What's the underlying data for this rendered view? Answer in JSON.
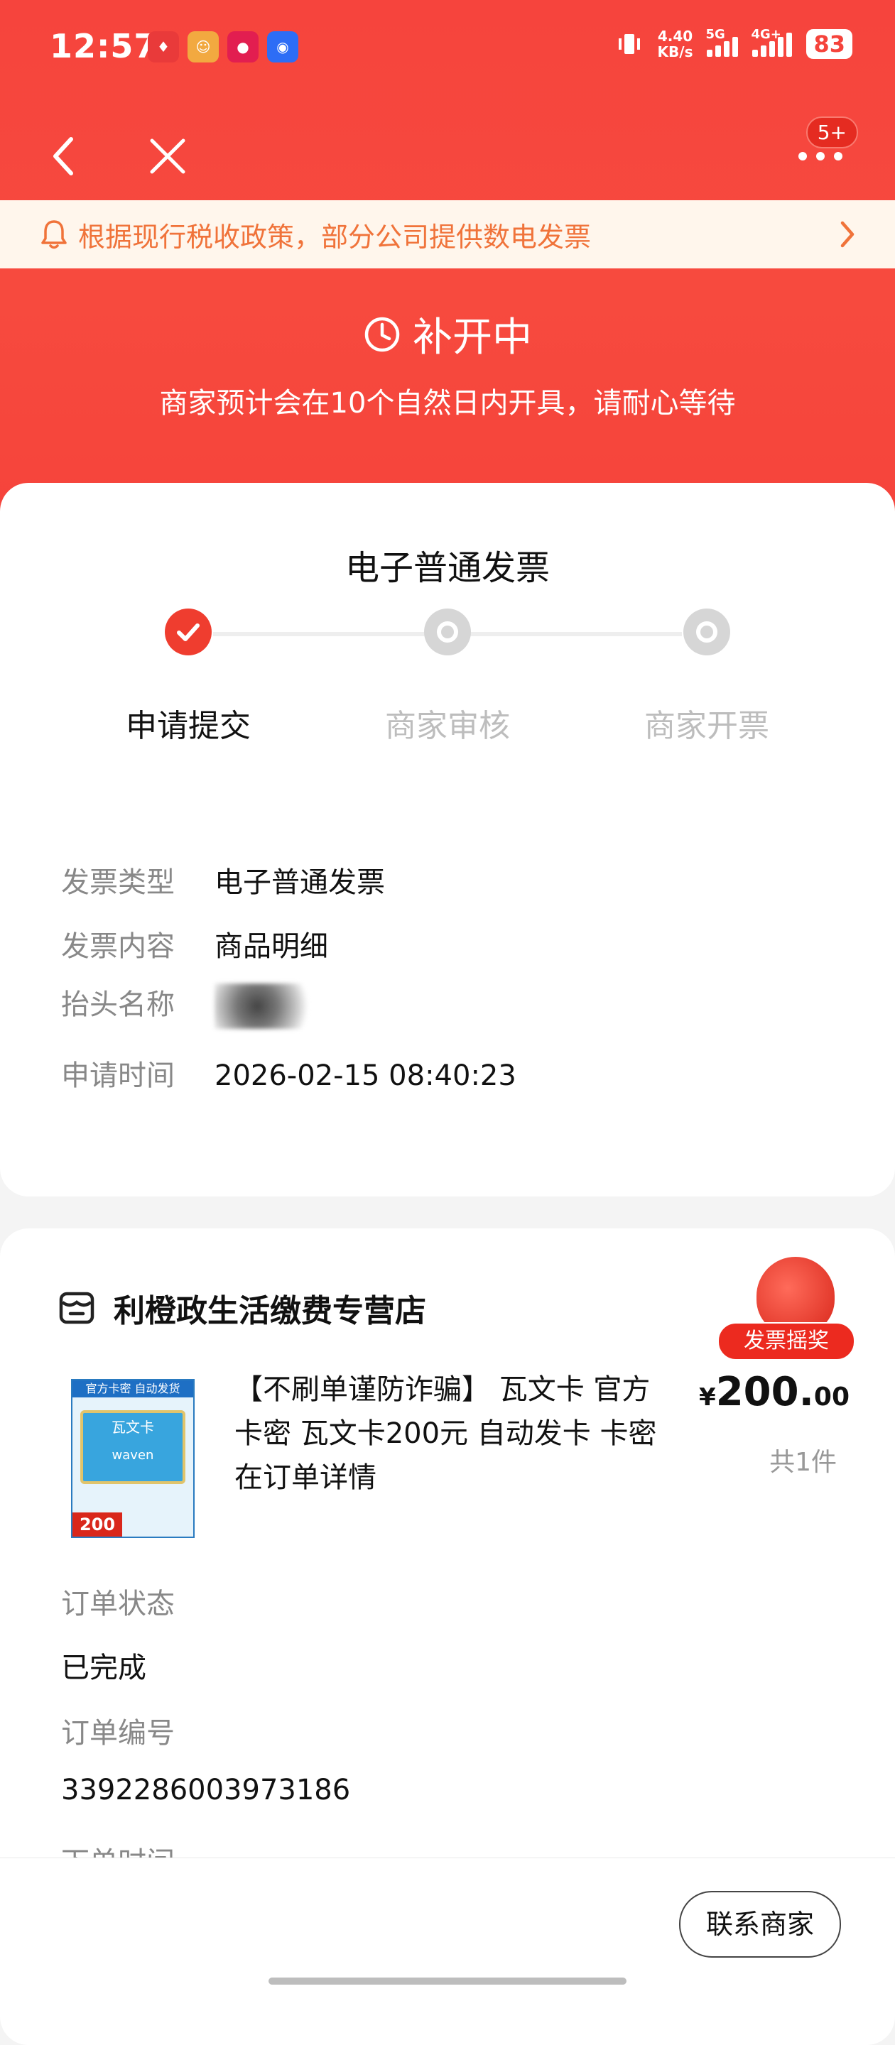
{
  "status_bar": {
    "time": "12:57",
    "speed_top": "4.40",
    "speed_bottom": "KB/s",
    "net1": "5G",
    "net2": "4G+",
    "battery": "83",
    "app_icons": [
      "app-icon-1",
      "app-icon-2",
      "app-icon-3",
      "app-icon-4"
    ]
  },
  "nav": {
    "badge": "5+"
  },
  "notice": {
    "text": "根据现行税收政策，部分公司提供数电发票"
  },
  "status": {
    "title": "补开中",
    "subtitle": "商家预计会在10个自然日内开具，请耐心等待"
  },
  "invoice": {
    "title": "电子普通发票",
    "steps": [
      {
        "label": "申请提交",
        "state": "done"
      },
      {
        "label": "商家审核",
        "state": "pending"
      },
      {
        "label": "商家开票",
        "state": "pending"
      }
    ],
    "details": [
      {
        "key": "发票类型",
        "value": "电子普通发票"
      },
      {
        "key": "发票内容",
        "value": "商品明细"
      },
      {
        "key": "抬头名称",
        "value": ""
      },
      {
        "key": "申请时间",
        "value": "2026-02-15 08:40:23"
      }
    ]
  },
  "order": {
    "store_name": "利橙政生活缴费专营店",
    "lottery_label": "发票摇奖",
    "product_title": "【不刷单谨防诈骗】 瓦文卡 官方卡密 瓦文卡200元 自动发卡 卡密在订单详情",
    "product_image": {
      "header": "官方卡密 自动发货",
      "card_text": "瓦文卡",
      "brand": "waven",
      "price_tag": "200 元"
    },
    "price_currency": "¥",
    "price_int": "200.",
    "price_dec": "00",
    "quantity": "共1件",
    "status_label": "订单状态",
    "status_value": "已完成",
    "number_label": "订单编号",
    "number_value": "3392286003973186",
    "time_label": "下单时间"
  },
  "bottom": {
    "contact_label": "联系商家"
  },
  "colors": {
    "brand_red": "#f5433b",
    "notice_text": "#f0733a",
    "notice_bg": "#fff6ec"
  }
}
